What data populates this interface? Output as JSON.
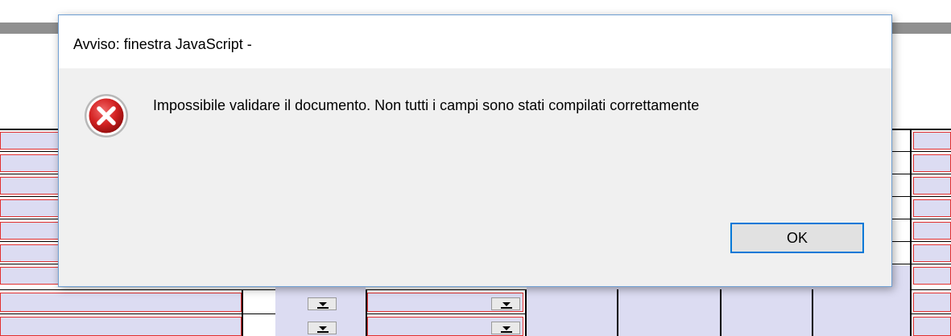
{
  "dialog": {
    "title": "Avviso: finestra JavaScript -",
    "message": "Impossibile validare il documento. Non tutti i campi sono stati compilati correttamente",
    "ok_label": "OK",
    "icon": "error-icon"
  },
  "colors": {
    "field_fill": "#dcdcf2",
    "field_border": "#e23030",
    "accent": "#0078d7",
    "dialog_bg": "#f0f0f0"
  }
}
